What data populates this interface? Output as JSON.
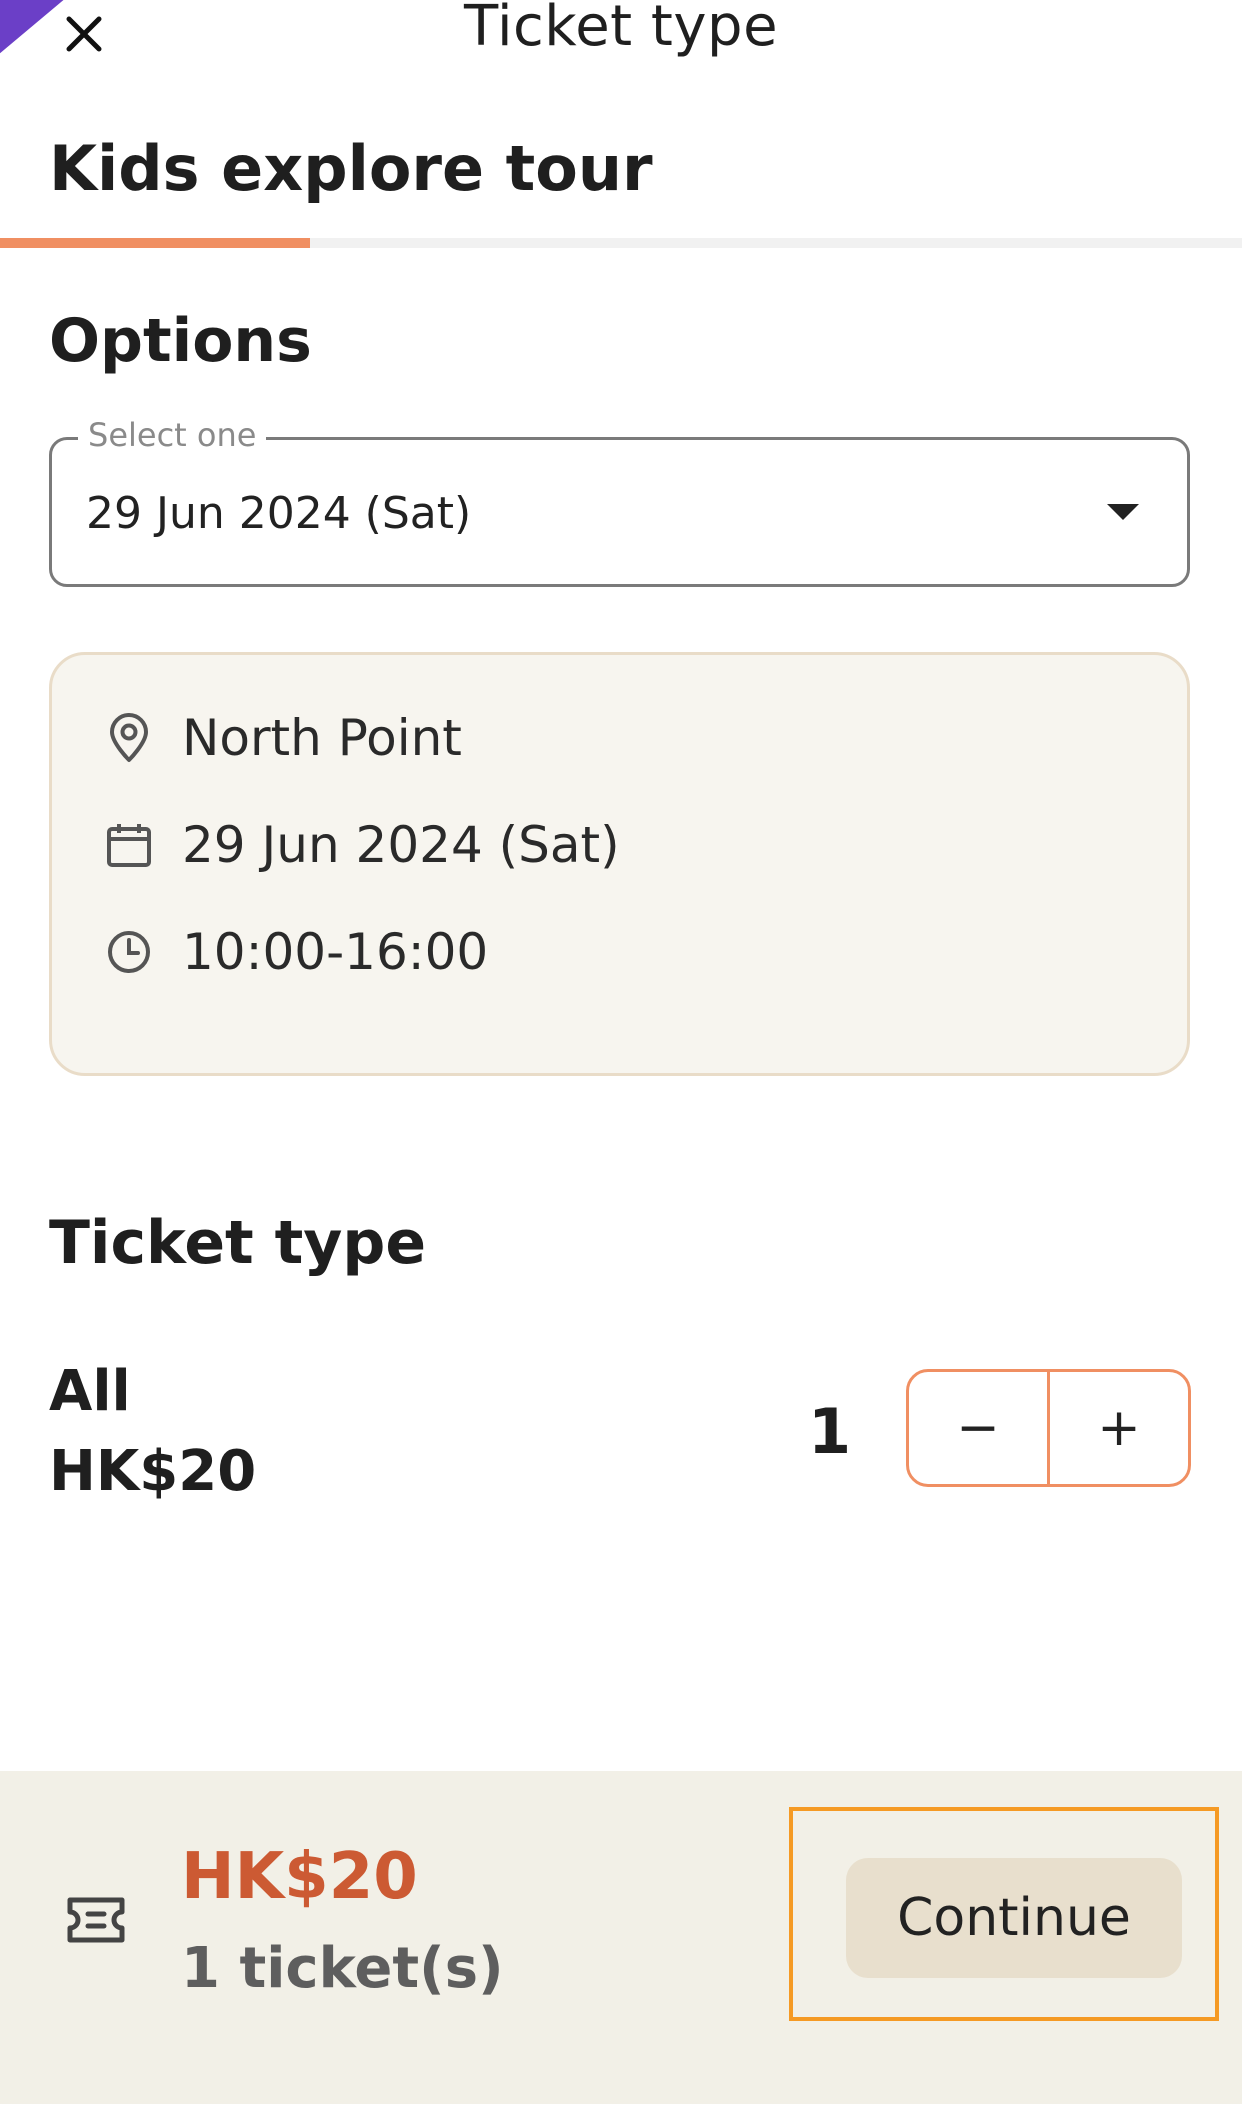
{
  "header": {
    "title": "Ticket type"
  },
  "tour": {
    "name": "Kids explore tour"
  },
  "options": {
    "heading": "Options",
    "select_legend": "Select one",
    "selected_value": "29 Jun 2024 (Sat)"
  },
  "details": {
    "location": "North Point",
    "date": "29 Jun 2024 (Sat)",
    "time": "10:00-16:00"
  },
  "ticket": {
    "heading": "Ticket type",
    "category": "All",
    "price": "HK$20",
    "quantity": "1",
    "minus_label": "−",
    "plus_label": "+"
  },
  "footer": {
    "total": "HK$20",
    "count": "1 ticket(s)",
    "continue_label": "Continue"
  },
  "colors": {
    "accent": "#f08f62",
    "price": "#cc5a33",
    "highlight": "#f59a24",
    "card_bg": "#f7f5ef",
    "footer_bg": "#f2f0e7",
    "button_bg": "#e8dfcd"
  },
  "icons": [
    "close-icon",
    "location-pin-icon",
    "calendar-icon",
    "clock-icon",
    "chevron-down-icon",
    "ticket-icon"
  ]
}
